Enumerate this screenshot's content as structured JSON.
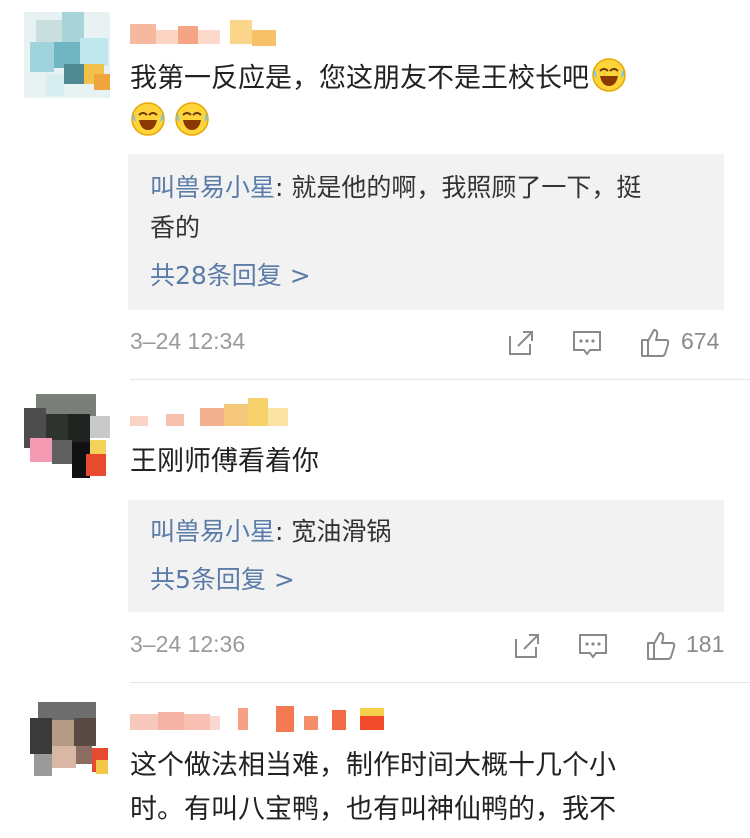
{
  "icons": {
    "share": "share-icon",
    "reply": "reply-icon",
    "like": "thumb-up-icon",
    "emoji": "laughing-crying-emoji"
  },
  "colors": {
    "reply_name": "#5b7ba8",
    "meta_text": "#9a9a9a",
    "reply_bg": "#f2f2f2"
  },
  "comments": [
    {
      "text_line1": "我第一反应是，您这朋友不是王校长吧",
      "reply": {
        "name": "叫兽易小星",
        "text_line1": ": 就是他的啊，我照顾了一下，挺",
        "text_line2": "香的",
        "count": "共28条回复 >"
      },
      "time": "3–24 12:34",
      "likes": "674"
    },
    {
      "text_line1": "王刚师傅看着你",
      "reply": {
        "name": "叫兽易小星",
        "text_line1": ": 宽油滑锅",
        "count": "共5条回复 >"
      },
      "time": "3–24 12:36",
      "likes": "181"
    },
    {
      "text_line1": "这个做法相当难，制作时间大概十几个小",
      "text_line2": "时。有叫八宝鸭，也有叫神仙鸭的，我不"
    }
  ]
}
